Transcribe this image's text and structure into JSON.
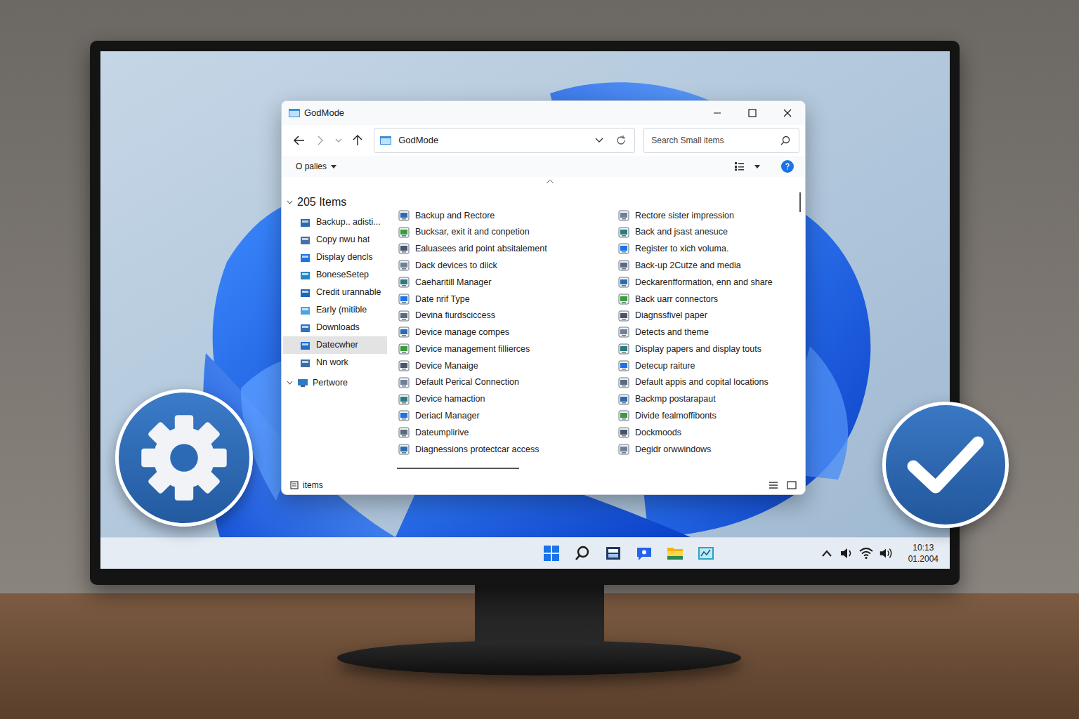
{
  "window": {
    "title": "GodMode"
  },
  "address": {
    "path": "GodMode"
  },
  "search": {
    "placeholder": "Search Small items"
  },
  "toolbar": {
    "label": "O palies"
  },
  "sidebar": {
    "header": {
      "label": "205 Items",
      "expanded": true
    },
    "items": [
      {
        "label": "Backup.. adisti...",
        "selected": false
      },
      {
        "label": "Copy nwu hat",
        "selected": false
      },
      {
        "label": "Display dencls",
        "selected": false
      },
      {
        "label": "BoneseSetep",
        "selected": false
      },
      {
        "label": "Credit urannable",
        "selected": false
      },
      {
        "label": "Early (mitible",
        "selected": false
      },
      {
        "label": "Downloads",
        "selected": false
      },
      {
        "label": "Datecwher",
        "selected": true
      },
      {
        "label": "Nn work",
        "selected": false
      }
    ],
    "groups": [
      {
        "label": "Pertwore",
        "expanded": true
      }
    ]
  },
  "items": {
    "columns": [
      [
        "Backup and Rectore",
        "Bucksar, exit it and conpetion",
        "Ealuasees arid point absitalement",
        "Dack devices to diick",
        "Caeharitill Manager",
        "Date nrif Type",
        "Devina fiurdsciccess",
        "Device manage compes",
        "Device management fillierces",
        "Device Manaige",
        "Default Perical Connection",
        "Device hamaction",
        "Deriacl Manager",
        "Dateumplirive",
        "Diagnessions protectcar access"
      ],
      [
        "Rectore sister impression",
        "Back and jsast anesuce",
        "Register to xich voluma.",
        "Back-up 2Cutze and media",
        "Deckarenfformation, enn and share",
        "Back uarr connectors",
        "Diagnssfivel paper",
        "Detects and theme",
        "Display papers and display touts",
        "Detecup raiture",
        "Default appis and copital locations",
        "Backmp postarapaut",
        "Divide fealmoffibonts",
        "Dockmoods",
        "Degidr orwwindows"
      ]
    ]
  },
  "status_bar": {
    "text": "items"
  },
  "taskbar": {
    "time": "10:13",
    "date": "01.2004"
  }
}
